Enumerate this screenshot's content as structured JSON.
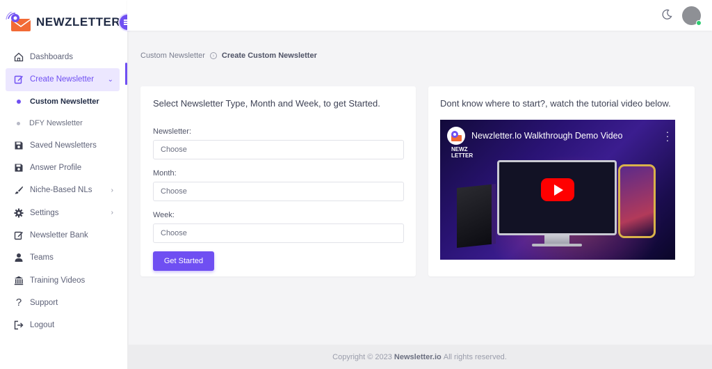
{
  "brand": {
    "name": "NEWZLETTER"
  },
  "sidebar": {
    "items": [
      {
        "label": "Dashboards",
        "icon": "home-icon"
      },
      {
        "label": "Create Newsletter",
        "icon": "edit-icon"
      },
      {
        "label": "Saved Newsletters",
        "icon": "save-icon"
      },
      {
        "label": "Answer Profile",
        "icon": "save-icon"
      },
      {
        "label": "Niche-Based NLs",
        "icon": "brush-icon"
      },
      {
        "label": "Settings",
        "icon": "gear-icon"
      },
      {
        "label": "Newsletter Bank",
        "icon": "edit-icon"
      },
      {
        "label": "Teams",
        "icon": "user-icon"
      },
      {
        "label": "Training Videos",
        "icon": "bank-icon"
      },
      {
        "label": "Support",
        "icon": "question-icon"
      },
      {
        "label": "Logout",
        "icon": "logout-icon"
      }
    ],
    "sub_items": [
      {
        "label": "Custom Newsletter"
      },
      {
        "label": "DFY Newsletter"
      }
    ]
  },
  "breadcrumb": {
    "parent": "Custom Newsletter",
    "current": "Create Custom Newsletter"
  },
  "form_card": {
    "title": "Select Newsletter Type, Month and Week, to get Started.",
    "newsletter_label": "Newsletter:",
    "newsletter_value": "Choose",
    "month_label": "Month:",
    "month_value": "Choose",
    "week_label": "Week:",
    "week_value": "Choose",
    "submit_label": "Get Started"
  },
  "video_card": {
    "title": "Dont know where to start?, watch the tutorial video below.",
    "video_title": "Newzletter.Io Walkthrough Demo Video",
    "video_logo": "NEWZ LETTER"
  },
  "footer": {
    "prefix": "Copyright © 2023",
    "brand": "Newsletter.io",
    "suffix": "All rights reserved."
  },
  "colors": {
    "accent": "#6f4ff2",
    "online": "#2ecc71",
    "play": "#ff0000"
  }
}
